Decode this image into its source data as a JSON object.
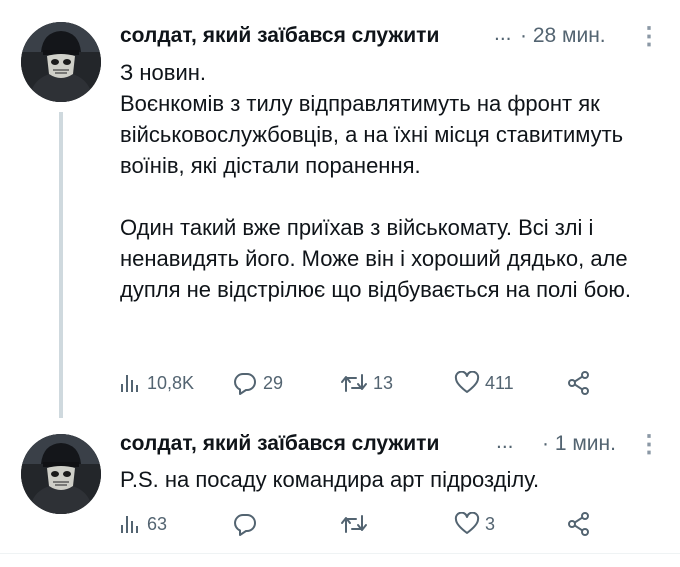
{
  "tweets": [
    {
      "author": "солдат, який заїбався служити",
      "ellipsis": "...",
      "time": "· 28 мин.",
      "more": "⋮",
      "text": "З новин.\nВоєнкомів з тилу відправлятимуть на фронт як військовослужбовців, а на їхні місця ставитимуть воїнів, які дістали поранення.\n\nОдин такий вже приїхав з військомату. Всі злі і ненавидять його. Може він і хороший дядько, але дупля не відстрілює що відбувається на полі бою.",
      "views": "10,8K",
      "replies": "29",
      "reposts": "13",
      "likes": "411"
    },
    {
      "author": "солдат, який заїбався служити",
      "ellipsis": "...",
      "time": "· 1 мин.",
      "more": "⋮",
      "text": "P.S. на посаду командира арт підрозділу.",
      "views": "63",
      "replies": "",
      "reposts": "",
      "likes": "3"
    }
  ],
  "icons": {
    "views": "views-icon",
    "reply": "reply-icon",
    "repost": "repost-icon",
    "like": "like-icon",
    "share": "share-icon",
    "more": "more-icon"
  },
  "colors": {
    "text": "#0f1419",
    "muted": "#536471",
    "thread_line": "#cfd9de"
  }
}
